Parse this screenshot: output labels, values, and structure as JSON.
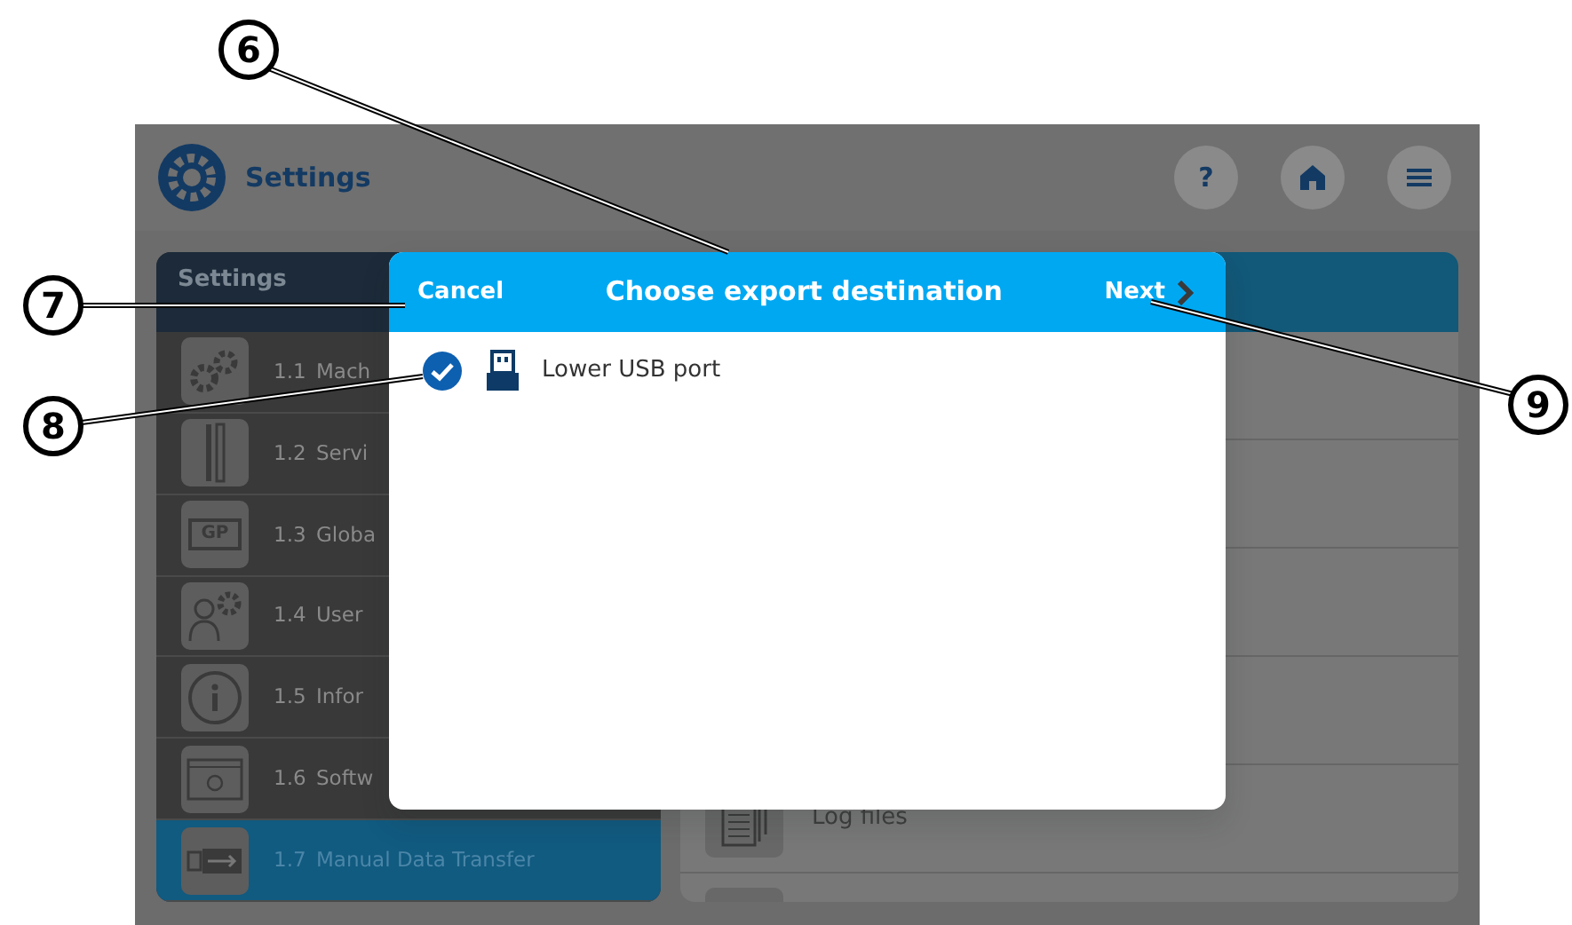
{
  "header": {
    "title": "Settings",
    "buttons": [
      {
        "kind": "help",
        "label": "?"
      },
      {
        "kind": "home"
      },
      {
        "kind": "menu"
      }
    ]
  },
  "sidebar": {
    "title": "Settings",
    "items": [
      {
        "number": "1.1",
        "label": "Mach",
        "kind": "gears",
        "selected": false
      },
      {
        "number": "1.2",
        "label": "Servi",
        "kind": "tools",
        "selected": false
      },
      {
        "number": "1.3",
        "label": "Globa",
        "kind": "gp",
        "icon_text": "GP",
        "selected": false
      },
      {
        "number": "1.4",
        "label": "User",
        "kind": "user-gear",
        "selected": false
      },
      {
        "number": "1.5",
        "label": "Infor",
        "kind": "info",
        "selected": false
      },
      {
        "number": "1.6",
        "label": "Softw",
        "kind": "software",
        "selected": false
      },
      {
        "number": "1.7",
        "label": "Manual Data Transfer",
        "kind": "usb",
        "selected": true
      }
    ]
  },
  "content": {
    "items": [
      {
        "kind": "documents",
        "label": "Log files"
      },
      {
        "kind": "cap"
      }
    ]
  },
  "dialog": {
    "title": "Choose export destination",
    "cancel": "Cancel",
    "next": "Next",
    "options": [
      {
        "label": "Lower USB port",
        "selected": true
      }
    ]
  },
  "callouts": [
    {
      "label": "6"
    },
    {
      "label": "7"
    },
    {
      "label": "8"
    },
    {
      "label": "9"
    }
  ]
}
